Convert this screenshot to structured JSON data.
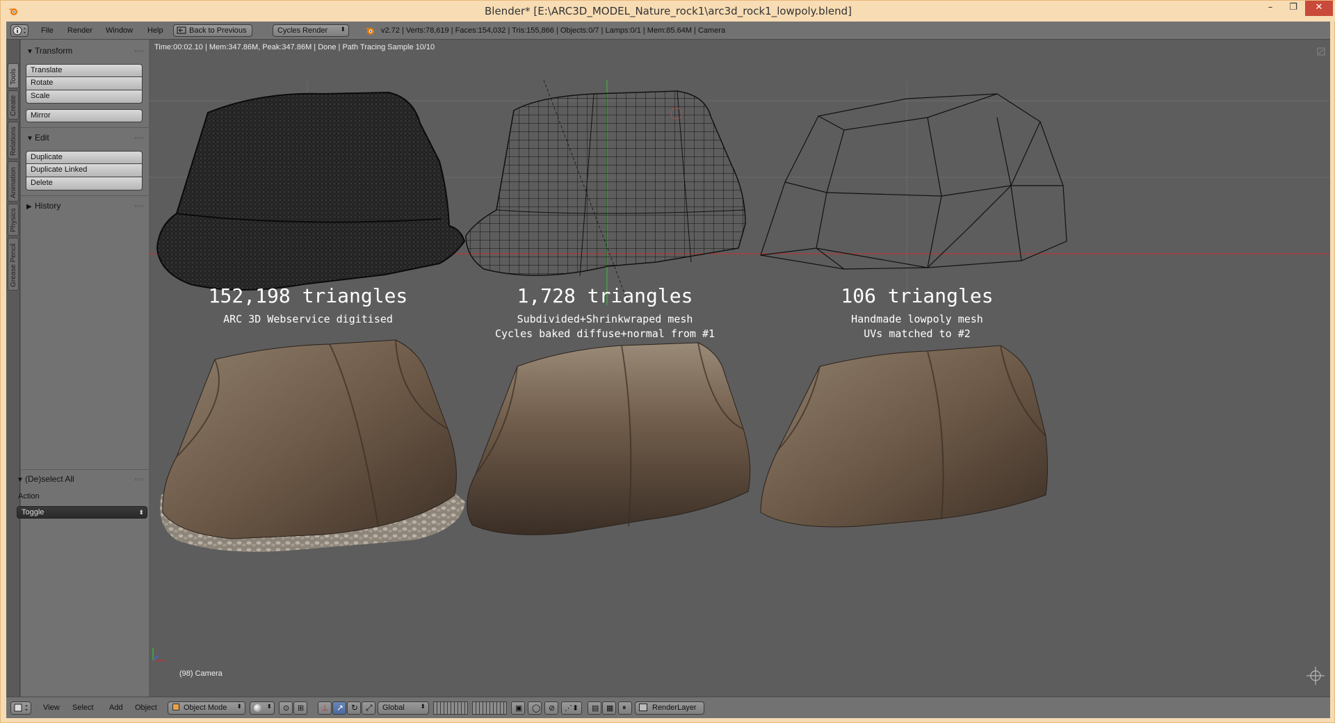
{
  "window": {
    "title": "Blender* [E:\\ARC3D_MODEL_Nature_rock1\\arc3d_rock1_lowpoly.blend]",
    "minimize": "–",
    "maximize": "❐",
    "close": "✕"
  },
  "info_header": {
    "menus": [
      "File",
      "Render",
      "Window",
      "Help"
    ],
    "back_label": "Back to Previous",
    "engine": "Cycles Render",
    "stats": "v2.72 | Verts:78,619 | Faces:154,032 | Tris:155,866 | Objects:0/7 | Lamps:0/1 | Mem:85.64M | Camera"
  },
  "shelf_tabs": [
    "Tools",
    "Create",
    "Relations",
    "Animation",
    "Physics",
    "Grease Pencil"
  ],
  "shelf": {
    "transform_title": "Transform",
    "transform_buttons": [
      "Translate",
      "Rotate",
      "Scale"
    ],
    "mirror": "Mirror",
    "edit_title": "Edit",
    "edit_buttons": [
      "Duplicate",
      "Duplicate Linked",
      "Delete"
    ],
    "history_title": "History"
  },
  "operator": {
    "title": "(De)select All",
    "action_label": "Action",
    "action_value": "Toggle"
  },
  "viewport": {
    "render_status": "Time:00:02.10 | Mem:347.86M, Peak:347.86M | Done | Path Tracing Sample 10/10",
    "camera_label": "(98) Camera",
    "models": [
      {
        "count": "152,198 triangles",
        "caption1": "ARC 3D Webservice digitised",
        "caption2": ""
      },
      {
        "count": "1,728 triangles",
        "caption1": "Subdivided+Shrinkwraped mesh",
        "caption2": "Cycles baked diffuse+normal from #1"
      },
      {
        "count": "106 triangles",
        "caption1": "Handmade lowpoly mesh",
        "caption2": "UVs matched to #2"
      }
    ]
  },
  "bottom_header": {
    "menus": [
      "View",
      "Select",
      "Add",
      "Object"
    ],
    "mode": "Object Mode",
    "orientation": "Global",
    "render_layer": "RenderLayer"
  },
  "colors": {
    "rock_dark": "#4a3b2e",
    "rock_mid": "#6e5a48",
    "rock_light": "#8f7e6c",
    "x_axis": "#b33a3a",
    "y_axis": "#3fae3f"
  }
}
